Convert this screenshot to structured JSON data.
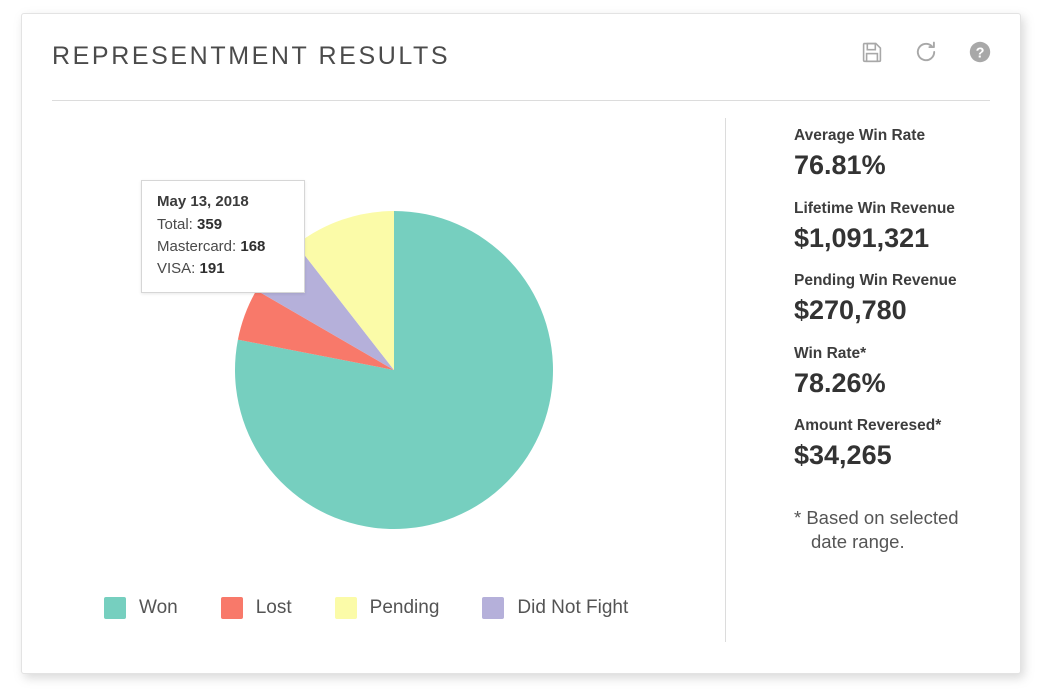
{
  "header": {
    "title": "REPRESENTMENT RESULTS",
    "icons": [
      {
        "name": "save-icon",
        "label": "Save"
      },
      {
        "name": "refresh-icon",
        "label": "Refresh"
      },
      {
        "name": "help-icon",
        "label": "Help"
      }
    ]
  },
  "tooltip": {
    "date": "May 13, 2018",
    "rows": [
      {
        "label": "Total:",
        "value": "359"
      },
      {
        "label": "Mastercard:",
        "value": "168"
      },
      {
        "label": "VISA:",
        "value": "191"
      }
    ]
  },
  "legend": [
    {
      "label": "Won",
      "color": "#76CFBF"
    },
    {
      "label": "Lost",
      "color": "#F8796A"
    },
    {
      "label": "Pending",
      "color": "#FBFBA8"
    },
    {
      "label": "Did Not Fight",
      "color": "#B5B0DA"
    }
  ],
  "stats": [
    {
      "label": "Average Win Rate",
      "value": "76.81%"
    },
    {
      "label": "Lifetime Win Revenue",
      "value": "$1,091,321"
    },
    {
      "label": "Pending Win Revenue",
      "value": "$270,780"
    },
    {
      "label": "Win Rate*",
      "value": "78.26%"
    },
    {
      "label": "Amount Reveresed*",
      "value": "$34,265"
    }
  ],
  "footnote": {
    "line1": "* Based on selected",
    "line2": "date range."
  },
  "chart_data": {
    "type": "pie",
    "title": "REPRESENTMENT RESULTS",
    "categories": [
      "Won",
      "Lost",
      "Did Not Fight",
      "Pending"
    ],
    "values": [
      78.1,
      5.3,
      6.1,
      10.5
    ],
    "value_unit": "percent",
    "angles_deg": [
      281.0,
      19.1,
      22.0,
      37.9
    ],
    "colors": [
      "#76CFBF",
      "#F8796A",
      "#B5B0DA",
      "#FBFBA8"
    ],
    "start_angle_deg": 0,
    "direction": "clockwise",
    "legend_position": "bottom-left",
    "grid": false,
    "annotation": {
      "date": "May 13, 2018",
      "total": 359,
      "mastercard": 168,
      "visa": 191
    }
  }
}
